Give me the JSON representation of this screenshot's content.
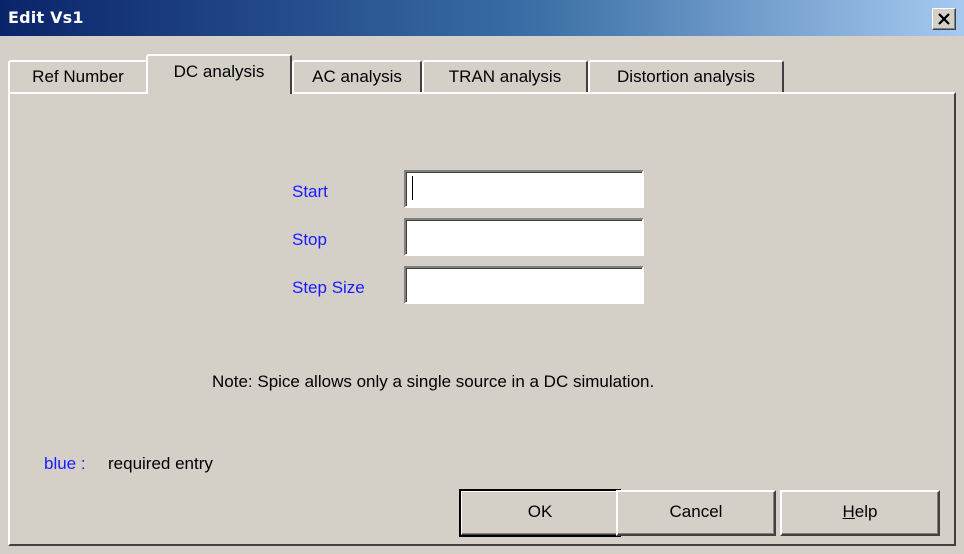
{
  "window": {
    "title": "Edit Vs1",
    "close_symbol": "×"
  },
  "tabs": [
    {
      "label": "Ref Number",
      "active": false
    },
    {
      "label": "DC analysis",
      "active": true
    },
    {
      "label": "AC analysis",
      "active": false
    },
    {
      "label": "TRAN analysis",
      "active": false
    },
    {
      "label": "Distortion analysis",
      "active": false
    }
  ],
  "form": {
    "start": {
      "label": "Start",
      "value": ""
    },
    "stop": {
      "label": "Stop",
      "value": ""
    },
    "step_size": {
      "label": "Step Size",
      "value": ""
    }
  },
  "note": "Note: Spice allows only a single source in a DC simulation.",
  "legend": {
    "key": "blue :",
    "value": "required entry"
  },
  "buttons": {
    "ok": "OK",
    "cancel": "Cancel",
    "help": "Help"
  },
  "colors": {
    "required_label": "#1a1aff",
    "titlebar_start": "#0a246a",
    "titlebar_end": "#a6caf0",
    "dialog_bg": "#d4d0c8"
  },
  "icons": {
    "close": "close-icon"
  }
}
